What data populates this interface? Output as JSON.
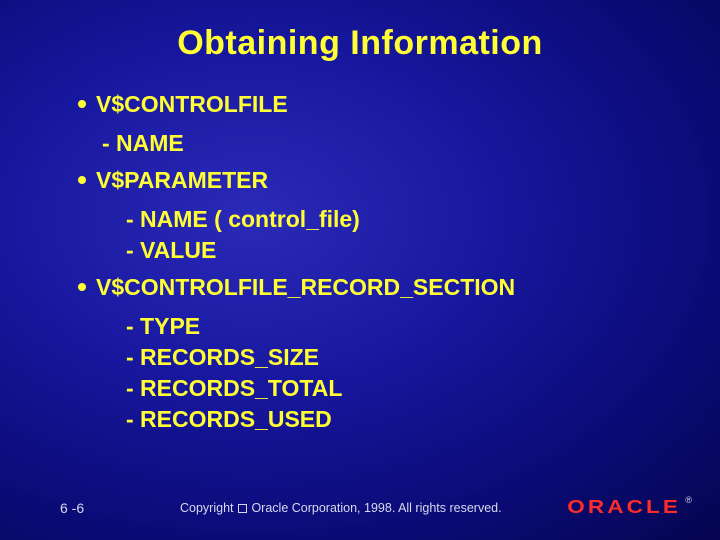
{
  "title": "Obtaining Information",
  "bullets": [
    {
      "head": "V$CONTROLFILE",
      "subs": [
        "- NAME"
      ],
      "sub_indent": "sub"
    },
    {
      "head": "V$PARAMETER",
      "subs": [
        "- NAME ( control_file)",
        "- VALUE"
      ],
      "sub_indent": "sub2"
    },
    {
      "head": "V$CONTROLFILE_RECORD_SECTION",
      "subs": [
        "- TYPE",
        "- RECORDS_SIZE",
        "- RECORDS_TOTAL",
        "- RECORDS_USED"
      ],
      "sub_indent": "sub2"
    }
  ],
  "footer": {
    "slide_number": "6 -6",
    "copyright_pre": "Copyright ",
    "copyright_post": " Oracle Corporation, 1998. All rights reserved.",
    "logo_text": "ORACLE",
    "registered": "®"
  }
}
